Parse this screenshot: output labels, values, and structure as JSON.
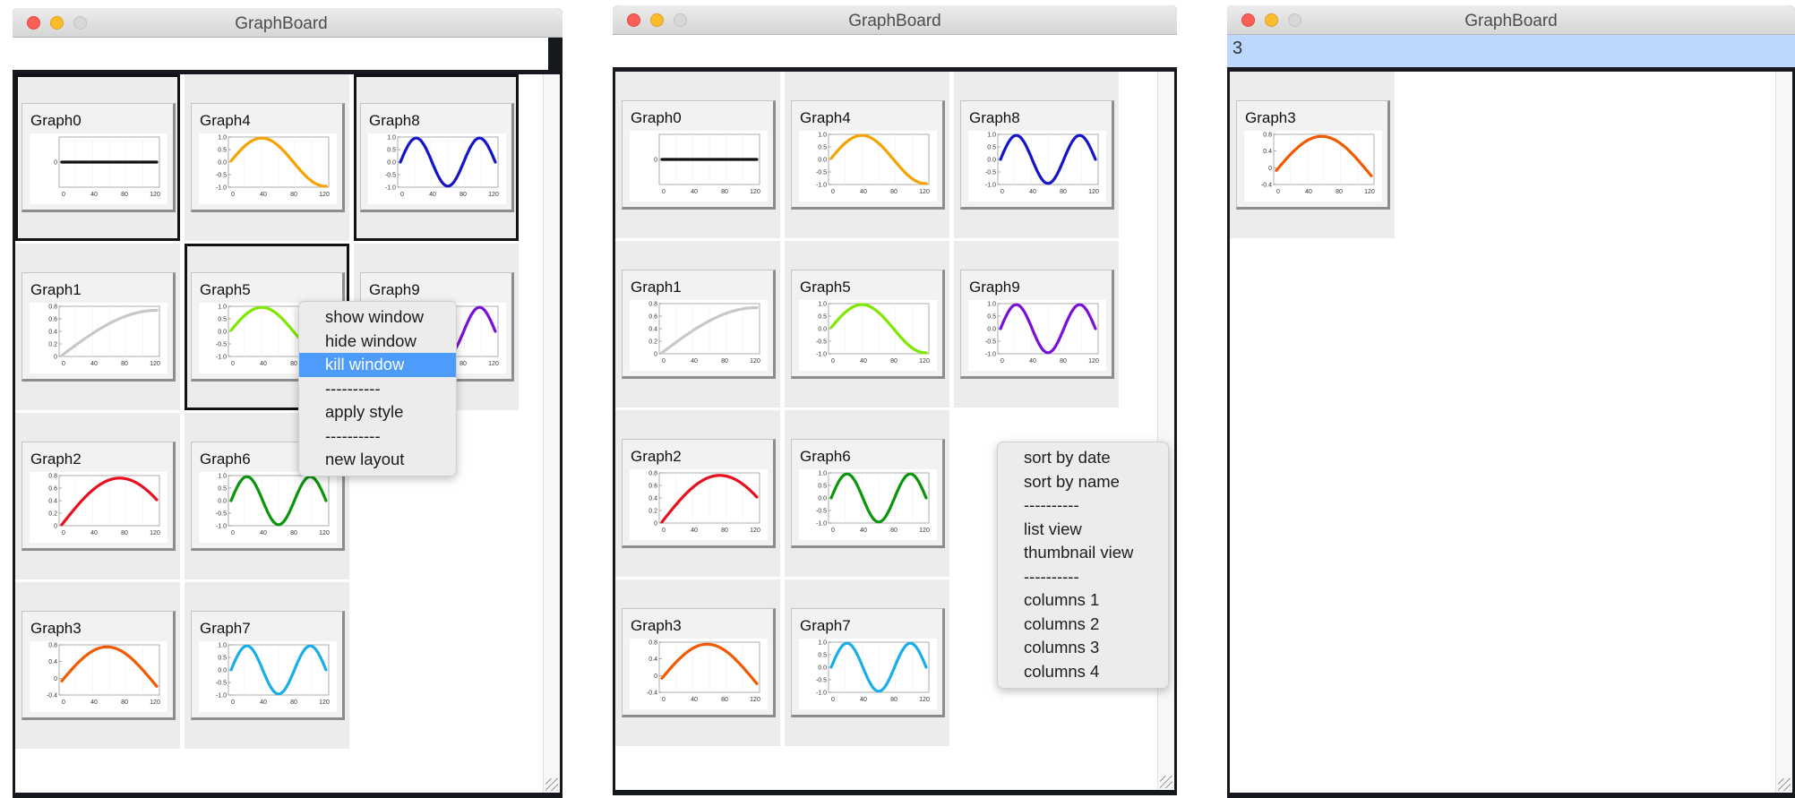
{
  "windows": [
    {
      "title": "GraphBoard",
      "input_value": "",
      "graphs": [
        {
          "name": "Graph0",
          "color": "#111111",
          "selected": true
        },
        {
          "name": "Graph4",
          "color": "#f5a300",
          "selected": false
        },
        {
          "name": "Graph8",
          "color": "#1414c8",
          "selected": true
        },
        {
          "name": "Graph1",
          "color": "#c8c8c8",
          "selected": false
        },
        {
          "name": "Graph5",
          "color": "#7ee800",
          "selected": true
        },
        {
          "name": "Graph9",
          "color": "#7a10d8",
          "selected": false
        },
        {
          "name": "Graph2",
          "color": "#e8101e",
          "selected": false
        },
        {
          "name": "Graph6",
          "color": "#0a960a",
          "selected": false
        },
        {
          "name": "Graph3",
          "color": "#f05a00",
          "selected": false
        },
        {
          "name": "Graph7",
          "color": "#1aaee8",
          "selected": false
        }
      ],
      "context_menu": {
        "items": [
          "show window",
          "hide window",
          "kill window",
          "----------",
          "apply style",
          "----------",
          "new layout"
        ],
        "highlighted": "kill window"
      }
    },
    {
      "title": "GraphBoard",
      "input_value": "",
      "graphs": [
        {
          "name": "Graph0",
          "color": "#111111",
          "selected": false
        },
        {
          "name": "Graph4",
          "color": "#f5a300",
          "selected": false
        },
        {
          "name": "Graph8",
          "color": "#1414c8",
          "selected": false
        },
        {
          "name": "Graph1",
          "color": "#c8c8c8",
          "selected": false
        },
        {
          "name": "Graph5",
          "color": "#7ee800",
          "selected": false
        },
        {
          "name": "Graph9",
          "color": "#7a10d8",
          "selected": false
        },
        {
          "name": "Graph2",
          "color": "#e8101e",
          "selected": false
        },
        {
          "name": "Graph6",
          "color": "#0a960a",
          "selected": false
        },
        {
          "name": "Graph3",
          "color": "#f05a00",
          "selected": false
        },
        {
          "name": "Graph7",
          "color": "#1aaee8",
          "selected": false
        }
      ],
      "context_menu": {
        "items": [
          "sort by date",
          "sort by name",
          "----------",
          "list view",
          "thumbnail view",
          "----------",
          "columns 1",
          "columns 2",
          "columns 3",
          "columns 4"
        ],
        "highlighted": ""
      }
    },
    {
      "title": "GraphBoard",
      "input_value": "3",
      "graphs": [
        {
          "name": "Graph3",
          "color": "#f05a00",
          "selected": false
        }
      ]
    }
  ],
  "chart_data": {
    "type": "line",
    "note_free": true,
    "thumbnails": {
      "flat": {
        "x": [
          0,
          120
        ],
        "y": [
          0,
          0
        ],
        "yticks": [
          "0"
        ]
      },
      "sine2": {
        "x_range": [
          0,
          120
        ],
        "cycles": 1,
        "yticks": [
          "1.0",
          "0.5",
          "0.0",
          "-0.5",
          "-1.0"
        ]
      },
      "sine3": {
        "x_range": [
          0,
          120
        ],
        "cycles": 1.5,
        "yticks": [
          "1.0",
          "0.5",
          "0.0",
          "-0.5",
          "-1.0"
        ]
      },
      "rise": {
        "x_range": [
          0,
          120
        ],
        "yticks": [
          "0.8",
          "0.6",
          "0.4",
          "0.2",
          "0"
        ]
      },
      "arch": {
        "x_range": [
          0,
          120
        ],
        "yticks": [
          "0.8",
          "0.6",
          "0.4",
          "0.2",
          "0"
        ]
      },
      "hump": {
        "x_range": [
          0,
          120
        ],
        "yticks": [
          "0.8",
          "0.4",
          "0",
          "-0.4"
        ]
      }
    },
    "xticks": [
      "0",
      "40",
      "80",
      "120"
    ]
  }
}
